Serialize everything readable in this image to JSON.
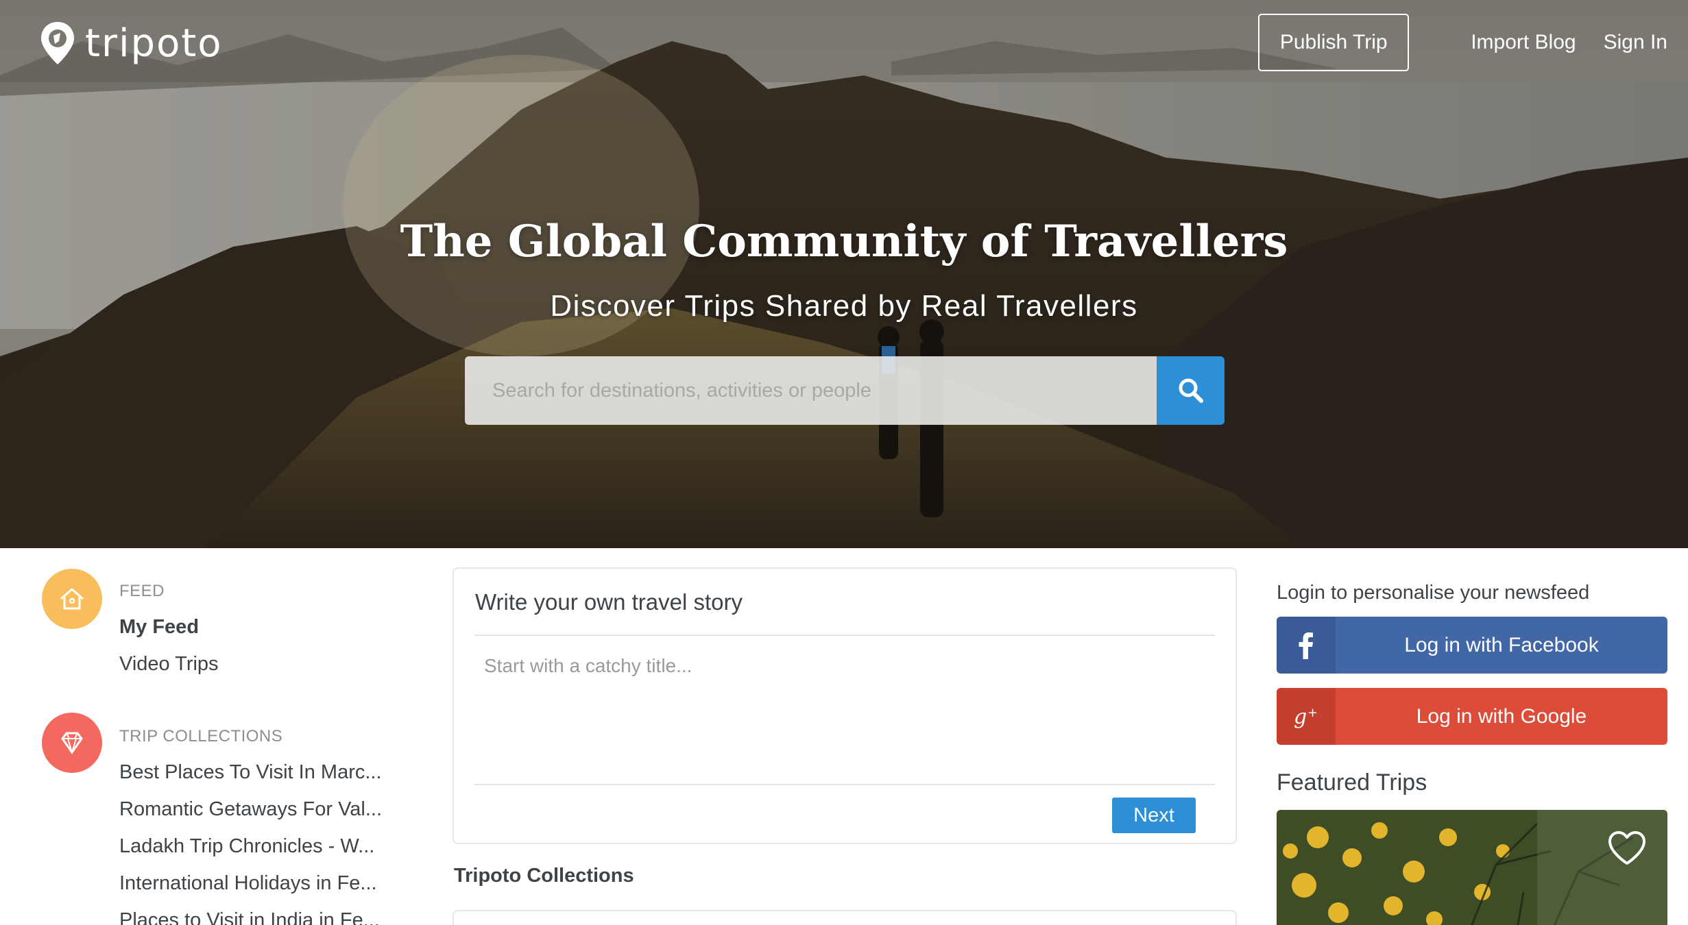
{
  "brand": {
    "name": "tripoto",
    "accent": "#2d8fd6"
  },
  "nav": {
    "publish_label": "Publish Trip",
    "import_label": "Import Blog",
    "signin_label": "Sign In"
  },
  "hero": {
    "title": "The Global Community of Travellers",
    "subtitle": "Discover Trips Shared by Real Travellers",
    "search_placeholder": "Search for destinations, activities or people",
    "search_icon": "magnifier-icon"
  },
  "sidebar": {
    "feed": {
      "icon": "home-icon",
      "icon_color": "#f9bd5c",
      "heading": "FEED",
      "items": [
        {
          "label": "My Feed",
          "active": true
        },
        {
          "label": "Video Trips",
          "active": false
        }
      ]
    },
    "collections": {
      "icon": "diamond-icon",
      "icon_color": "#f4695f",
      "heading": "TRIP COLLECTIONS",
      "items": [
        {
          "label": "Best Places To Visit In Marc..."
        },
        {
          "label": "Romantic Getaways For Val..."
        },
        {
          "label": "Ladakh Trip Chronicles - W..."
        },
        {
          "label": "International Holidays in Fe..."
        },
        {
          "label": "Places to Visit in India in Fe..."
        }
      ]
    }
  },
  "story": {
    "heading": "Write your own travel story",
    "title_placeholder": "Start with a catchy title...",
    "next_label": "Next"
  },
  "collections_section": {
    "heading": "Tripoto Collections"
  },
  "right": {
    "login_note": "Login to personalise your newsfeed",
    "facebook": {
      "label": "Log in with Facebook",
      "icon": "facebook-icon",
      "color": "#4267a7"
    },
    "google": {
      "label": "Log in with Google",
      "icon": "google-plus-icon",
      "color": "#dd4b39"
    },
    "featured_heading": "Featured Trips",
    "featured_icon": "heart-icon"
  }
}
